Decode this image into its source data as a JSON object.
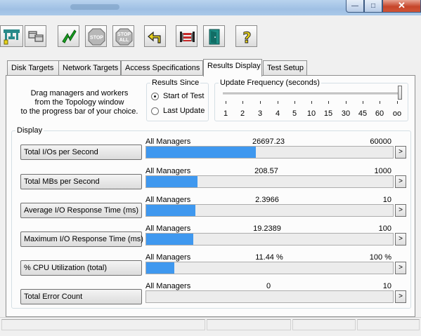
{
  "window": {
    "title": ""
  },
  "toolbar": {
    "buttons": [
      {
        "name": "topology-icon"
      },
      {
        "name": "config-window-icon"
      },
      {
        "name": "start-tests-icon"
      },
      {
        "name": "stop-icon",
        "label": "STOP"
      },
      {
        "name": "stop-all-icon",
        "label_top": "STOP",
        "label_bottom": "ALL"
      },
      {
        "name": "reset-workers-icon"
      },
      {
        "name": "start-manager-icon"
      },
      {
        "name": "exit-icon"
      },
      {
        "name": "help-icon",
        "label": "?"
      }
    ]
  },
  "tabs": [
    "Disk Targets",
    "Network Targets",
    "Access Specifications",
    "Results Display",
    "Test Setup"
  ],
  "active_tab": "Results Display",
  "hint": {
    "line1": "Drag managers and workers",
    "line2": "from the Topology window",
    "line3": "to the progress bar of your choice."
  },
  "results_since": {
    "legend": "Results Since",
    "options": [
      {
        "label": "Start of Test",
        "selected": true
      },
      {
        "label": "Last Update",
        "selected": false
      }
    ]
  },
  "update_frequency": {
    "legend": "Update Frequency (seconds)",
    "ticks": [
      "1",
      "2",
      "3",
      "4",
      "5",
      "10",
      "15",
      "30",
      "45",
      "60",
      "oo"
    ],
    "selected": "oo"
  },
  "display": {
    "legend": "Display",
    "rows": [
      {
        "label": "Total I/Os per Second",
        "target": "All Managers",
        "value": "26697.23",
        "max": "60000",
        "fraction": 0.445,
        "more": ">"
      },
      {
        "label": "Total MBs per Second",
        "target": "All Managers",
        "value": "208.57",
        "max": "1000",
        "fraction": 0.209,
        "more": ">"
      },
      {
        "label": "Average I/O Response Time (ms)",
        "target": "All Managers",
        "value": "2.3966",
        "max": "10",
        "fraction": 0.2,
        "more": ">"
      },
      {
        "label": "Maximum I/O Response Time (ms)",
        "target": "All Managers",
        "value": "19.2389",
        "max": "100",
        "fraction": 0.192,
        "more": ">"
      },
      {
        "label": "% CPU Utilization (total)",
        "target": "All Managers",
        "value": "11.44 %",
        "max": "100 %",
        "fraction": 0.114,
        "more": ">"
      },
      {
        "label": "Total Error Count",
        "target": "All Managers",
        "value": "0",
        "max": "10",
        "fraction": 0,
        "more": ">"
      }
    ]
  },
  "colors": {
    "bar_fill": "#3f98ef",
    "tab_border": "#8e8f8f"
  }
}
